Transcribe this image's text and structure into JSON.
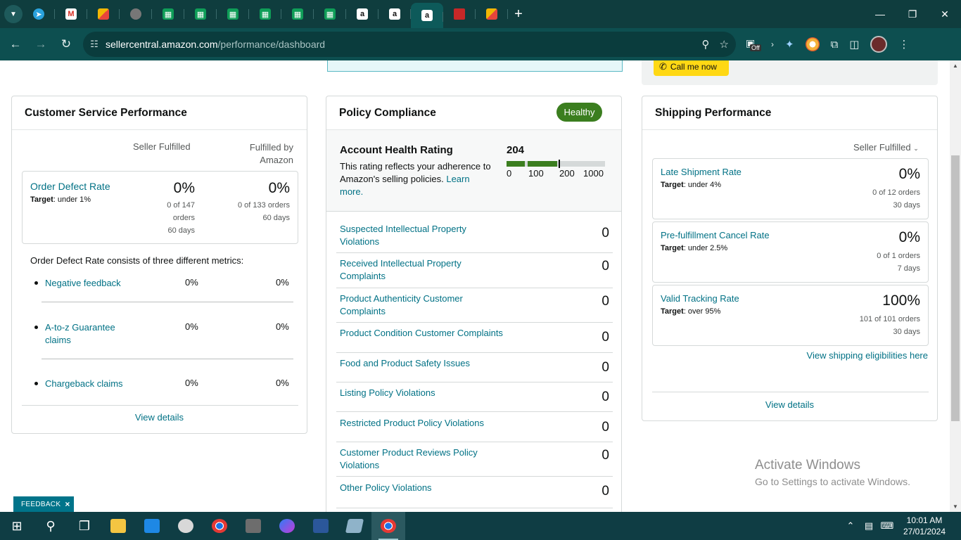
{
  "browser": {
    "url_domain": "sellercentral.amazon.com",
    "url_path": "/performance/dashboard",
    "ext_badge": "Off"
  },
  "colors": {
    "brand_teal": "#007185",
    "healthy_green": "#3b7e1f",
    "call_yellow": "#ffd814"
  },
  "top": {
    "call_label": "Call me now"
  },
  "customer_service": {
    "title": "Customer Service Performance",
    "col1": "Seller Fulfilled",
    "col2_line1": "Fulfilled by",
    "col2_line2": "Amazon",
    "odr": {
      "title": "Order Defect Rate",
      "target_label": "Target",
      "target_value": ": under 1%",
      "sf_pct": "0%",
      "sf_line1": "0 of 147",
      "sf_line2": "orders",
      "sf_line3": "60 days",
      "fba_pct": "0%",
      "fba_line1": "0 of 133 orders",
      "fba_line2": "60 days"
    },
    "description": "Order Defect Rate consists of three different metrics:",
    "metrics": [
      {
        "name": "Negative feedback",
        "sf": "0%",
        "fba": "0%"
      },
      {
        "name": "A-to-z Guarantee claims",
        "sf": "0%",
        "fba": "0%"
      },
      {
        "name": "Chargeback claims",
        "sf": "0%",
        "fba": "0%"
      }
    ],
    "view_details": "View details"
  },
  "policy": {
    "title": "Policy Compliance",
    "status": "Healthy",
    "ahr_title": "Account Health Rating",
    "ahr_desc": "This rating reflects your adherence to Amazon's selling policies.",
    "ahr_learn": "Learn more.",
    "ahr_score": "204",
    "ahr_score_value": 204,
    "ahr_ticks": [
      "0",
      "100",
      "200",
      "1000"
    ],
    "rows": [
      {
        "label": "Suspected Intellectual Property Violations",
        "count": "0"
      },
      {
        "label": "Received Intellectual Property Complaints",
        "count": "0"
      },
      {
        "label": "Product Authenticity Customer Complaints",
        "count": "0"
      },
      {
        "label": "Product Condition Customer Complaints",
        "count": "0"
      },
      {
        "label": "Food and Product Safety Issues",
        "count": "0"
      },
      {
        "label": "Listing Policy Violations",
        "count": "0"
      },
      {
        "label": "Restricted Product Policy Violations",
        "count": "0"
      },
      {
        "label": "Customer Product Reviews Policy Violations",
        "count": "0"
      },
      {
        "label": "Other Policy Violations",
        "count": "0"
      }
    ]
  },
  "shipping": {
    "title": "Shipping Performance",
    "selector": "Seller Fulfilled",
    "metrics": [
      {
        "name": "Late Shipment Rate",
        "target_label": "Target",
        "target_value": ": under 4%",
        "pct": "0%",
        "line1": "0 of 12 orders",
        "line2": "30 days"
      },
      {
        "name": "Pre-fulfillment Cancel Rate",
        "target_label": "Target",
        "target_value": ": under 2.5%",
        "pct": "0%",
        "line1": "0 of 1 orders",
        "line2": "7 days"
      },
      {
        "name": "Valid Tracking Rate",
        "target_label": "Target",
        "target_value": ": over 95%",
        "pct": "100%",
        "line1": "101 of 101 orders",
        "line2": "30 days"
      }
    ],
    "eligibility_link": "View shipping eligibilities here",
    "view_details": "View details"
  },
  "watermark": {
    "line1": "Activate Windows",
    "line2": "Go to Settings to activate Windows."
  },
  "feedback": {
    "label": "FEEDBACK",
    "close": "×"
  },
  "taskbar": {
    "time": "10:01 AM",
    "date": "27/01/2024"
  }
}
